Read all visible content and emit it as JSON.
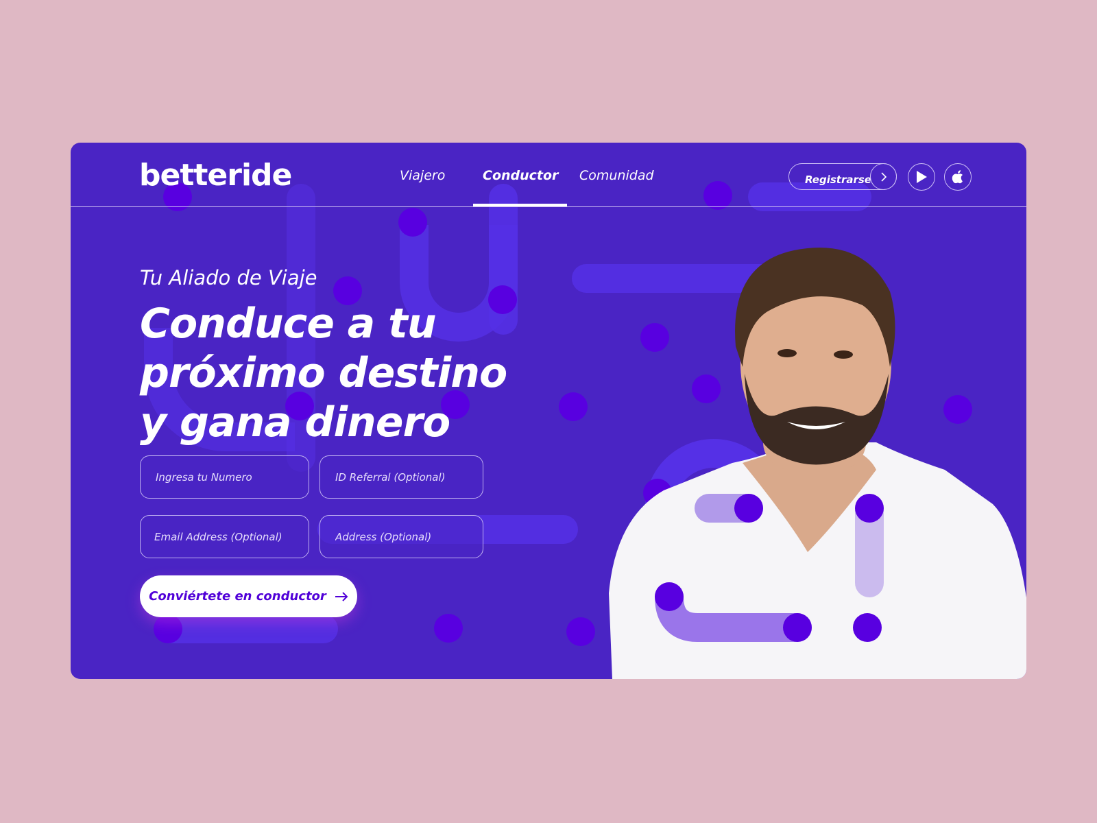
{
  "brand": {
    "logo": "betteride"
  },
  "nav": {
    "items": [
      {
        "label": "Viajero"
      },
      {
        "label": "Conductor",
        "active": true
      },
      {
        "label": "Comunidad"
      }
    ]
  },
  "header": {
    "register_label": "Registrarse",
    "chevron_icon": "chevron-right-icon",
    "play_icon": "google-play-icon",
    "apple_icon": "apple-icon"
  },
  "hero": {
    "subtitle": "Tu Aliado de Viaje",
    "headline_lines": [
      "Conduce a tu",
      "próximo destino",
      "y gana dinero"
    ]
  },
  "form": {
    "phone_placeholder": "Ingresa tu Numero",
    "referral_placeholder": "ID Referral (Optional)",
    "email_placeholder": "Email Address (Optional)",
    "address_placeholder": "Address (Optional)",
    "submit_label": "Conviértete en conductor",
    "submit_icon": "arrow-right-icon"
  },
  "colors": {
    "page_bg": "#dfb8c4",
    "card_bg": "#4a24c4",
    "dot": "#5800e0",
    "cta_text": "#5000d8"
  }
}
